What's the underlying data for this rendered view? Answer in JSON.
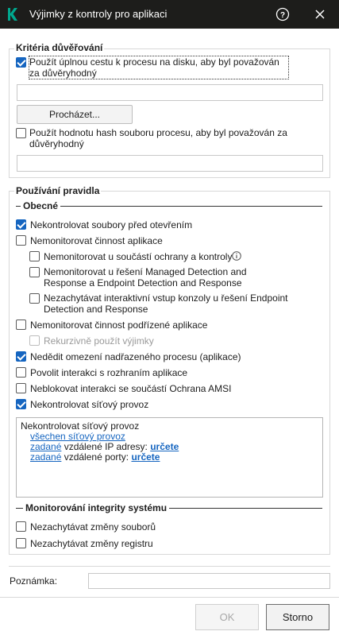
{
  "window": {
    "title": "Výjimky z kontroly pro aplikaci",
    "logo_letter": "K"
  },
  "trust": {
    "title": "Kritéria důvěřování",
    "use_full_path": {
      "checked": true,
      "label": "Použít úplnou cestu k procesu na disku, aby byl považován za důvěryhodný"
    },
    "path_value": "",
    "browse_button": "Procházet...",
    "use_hash": {
      "checked": false,
      "label": "Použít hodnotu hash souboru procesu, aby byl považován za důvěryhodný"
    },
    "hash_value": ""
  },
  "rules": {
    "title": "Používání pravidla",
    "general_section": "Obecné",
    "items": [
      {
        "id": "no-scan-files",
        "checked": true,
        "label": "Nekontrolovat soubory před otevřením",
        "indent": 0
      },
      {
        "id": "no-monitor-activity",
        "checked": false,
        "label": "Nemonitorovat činnost aplikace",
        "indent": 0
      },
      {
        "id": "no-monitor-protection",
        "checked": false,
        "label": "Nemonitorovat u součástí ochrany a kontroly",
        "indent": 1
      },
      {
        "id": "no-monitor-mdr",
        "checked": false,
        "label": "Nemonitorovat u řešení Managed Detection and Response a Endpoint Detection and Response",
        "indent": 1
      },
      {
        "id": "no-intercept-console",
        "checked": false,
        "label": "Nezachytávat interaktivní vstup konzoly u řešení Endpoint Detection and Response",
        "indent": 1
      },
      {
        "id": "no-monitor-child",
        "checked": false,
        "label": "Nemonitorovat činnost podřízené aplikace",
        "indent": 0
      },
      {
        "id": "recursive",
        "checked": false,
        "label": "Rekurzivně použít výjimky",
        "indent": 1,
        "disabled": true
      },
      {
        "id": "no-inherit",
        "checked": true,
        "label": "Nedědit omezení nadřazeného procesu (aplikace)",
        "indent": 0
      },
      {
        "id": "allow-interface",
        "checked": false,
        "label": "Povolit interakci s rozhraním aplikace",
        "indent": 0
      },
      {
        "id": "no-block-amsi",
        "checked": false,
        "label": "Neblokovat interakci se součástí Ochrana AMSI",
        "indent": 0
      },
      {
        "id": "no-scan-network",
        "checked": true,
        "label": "Nekontrolovat síťový provoz",
        "indent": 0
      }
    ],
    "network_box": {
      "heading": "Nekontrolovat síťový provoz",
      "all_traffic_link": "všechen síťový provoz",
      "ip_line": {
        "link1": "zadané",
        "text": " vzdálené IP adresy: ",
        "link2": "určete"
      },
      "port_line": {
        "link1": "zadané",
        "text": " vzdálené porty: ",
        "link2": "určete"
      }
    },
    "integrity_section": "Monitorování integrity systému",
    "integrity_items": [
      {
        "id": "no-file-changes",
        "checked": false,
        "label": "Nezachytávat změny souborů"
      },
      {
        "id": "no-registry-changes",
        "checked": false,
        "label": "Nezachytávat změny registru"
      }
    ]
  },
  "note": {
    "label": "Poznámka:",
    "value": ""
  },
  "footer": {
    "ok": "OK",
    "cancel": "Storno"
  },
  "colors": {
    "titlebar": "#1d1d1b",
    "logo": "#00a88e",
    "accent": "#1565c0"
  }
}
